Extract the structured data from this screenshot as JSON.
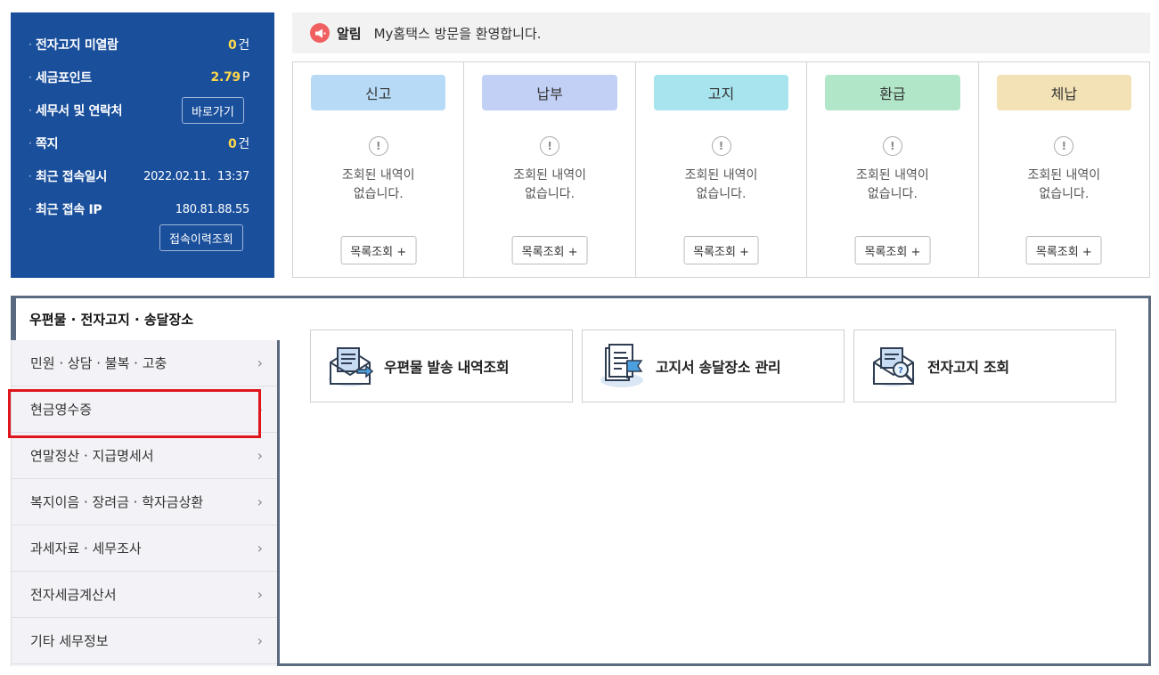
{
  "info": {
    "unread_label": "전자고지 미열람",
    "unread_value": "0",
    "unread_unit": "건",
    "points_label": "세금포인트",
    "points_value": "2.79",
    "points_unit": "P",
    "office_label": "세무서 및 연락처",
    "office_button": "바로가기",
    "notes_label": "쪽지",
    "notes_value": "0",
    "notes_unit": "건",
    "last_login_label": "최근 접속일시",
    "last_login_value": "2022.02.11.  13:37",
    "last_ip_label": "최근 접속 IP",
    "last_ip_value": "180.81.88.55",
    "history_button": "접속이력조회"
  },
  "notice": {
    "label": "알림",
    "text": "My홈택스 방문을 환영합니다."
  },
  "status": [
    {
      "title": "신고",
      "empty_line1": "조회된 내역이",
      "empty_line2": "없습니다.",
      "button": "목록조회 +",
      "color": "#b7dbf6"
    },
    {
      "title": "납부",
      "empty_line1": "조회된 내역이",
      "empty_line2": "없습니다.",
      "button": "목록조회 +",
      "color": "#c2d0f5"
    },
    {
      "title": "고지",
      "empty_line1": "조회된 내역이",
      "empty_line2": "없습니다.",
      "button": "목록조회 +",
      "color": "#a8e4ee"
    },
    {
      "title": "환급",
      "empty_line1": "조회된 내역이",
      "empty_line2": "없습니다.",
      "button": "목록조회 +",
      "color": "#b2e6c9"
    },
    {
      "title": "체납",
      "empty_line1": "조회된 내역이",
      "empty_line2": "없습니다.",
      "button": "목록조회 +",
      "color": "#f3e2b6"
    }
  ],
  "menu": {
    "active_tab": "우편물 · 전자고지 · 송달장소",
    "items": [
      {
        "label": "민원 · 상담 · 불복 · 고충"
      },
      {
        "label": "현금영수증"
      },
      {
        "label": "연말정산 · 지급명세서"
      },
      {
        "label": "복지이음 · 장려금 · 학자금상환"
      },
      {
        "label": "과세자료 · 세무조사"
      },
      {
        "label": "전자세금계산서"
      },
      {
        "label": "기타 세무정보"
      }
    ],
    "highlighted_index": 2
  },
  "services": [
    {
      "label": "우편물 발송 내역조회",
      "icon": "mail-list-icon"
    },
    {
      "label": "고지서 송달장소 관리",
      "icon": "document-flag-icon"
    },
    {
      "label": "전자고지 조회",
      "icon": "mail-search-icon"
    }
  ],
  "colors": {
    "panel_blue": "#1a4f9c",
    "value_yellow": "#ffd84a",
    "notice_red": "#f06060",
    "frame_slate": "#5a6a80",
    "highlight_red": "#e0141c"
  }
}
